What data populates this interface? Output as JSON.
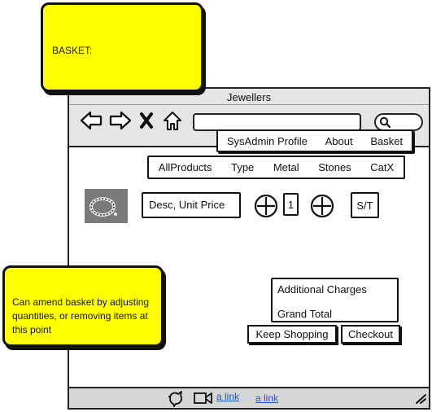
{
  "window": {
    "title": "Jewellers"
  },
  "top_menu": [
    "SysAdmin Profile",
    "About",
    "Basket"
  ],
  "category_menu": [
    "AllProducts",
    "Type",
    "Metal",
    "Stones",
    "CatX"
  ],
  "basket_item": {
    "description": "Desc, Unit Price",
    "quantity": "1",
    "subtotal": "S/T"
  },
  "totals": {
    "additional_charges": "Additional Charges",
    "grand_total": "Grand Total"
  },
  "actions": {
    "keep_shopping": "Keep Shopping",
    "checkout": "Checkout"
  },
  "notes": {
    "heading": "BASKET:",
    "amend": "Can amend basket by adjusting quantities, or removing items at this point"
  },
  "footer": {
    "link1": "a link",
    "link2": "a link"
  }
}
